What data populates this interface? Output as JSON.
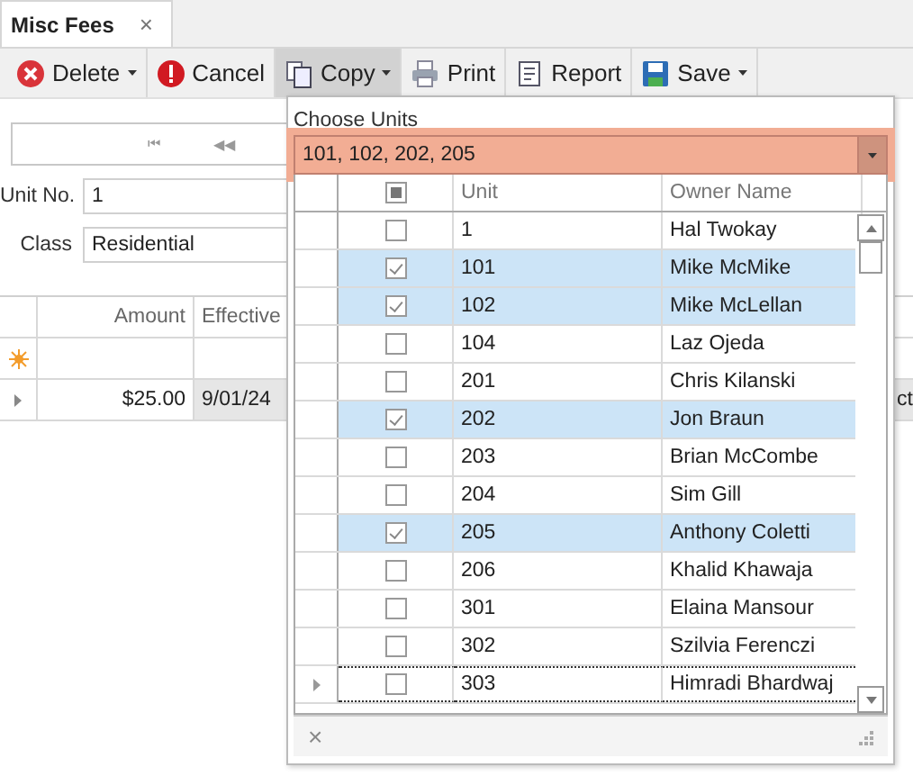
{
  "tabs": [
    {
      "label": "Misc Fees",
      "selected": true,
      "close": "×"
    }
  ],
  "toolbar": [
    {
      "kind": "delete",
      "label": "Delete",
      "dropdown": true,
      "pressed": false
    },
    {
      "kind": "cancel",
      "label": "Cancel",
      "dropdown": false,
      "pressed": false
    },
    {
      "kind": "copy",
      "label": "Copy",
      "dropdown": true,
      "pressed": true
    },
    {
      "kind": "print",
      "label": "Print",
      "dropdown": false,
      "pressed": false
    },
    {
      "kind": "report",
      "label": "Report",
      "dropdown": false,
      "pressed": false
    },
    {
      "kind": "save",
      "label": "Save",
      "dropdown": true,
      "pressed": false
    }
  ],
  "navigator": {
    "buttons": [
      "⏮",
      "◀◀"
    ]
  },
  "form": [
    {
      "label": "Unit No.",
      "value": "1"
    },
    {
      "label": "Class",
      "value": "Residential"
    }
  ],
  "grid": {
    "columns": [
      "Amount",
      "Effective"
    ],
    "rows": [
      {
        "kind": "new",
        "cells": [
          "",
          ""
        ]
      },
      {
        "kind": "data",
        "cells": [
          "$25.00",
          "9/01/24"
        ],
        "extra": "ct"
      }
    ]
  },
  "popup": {
    "title": "Choose Units",
    "value": "101, 102, 202, 205",
    "highlighted": true,
    "header_checkbox": {
      "indeterminate": true
    },
    "columns": [
      "Unit",
      "Owner Name"
    ],
    "rows": [
      {
        "unit": "1",
        "owner": "Hal Twokay",
        "checked": false,
        "current": false
      },
      {
        "unit": "101",
        "owner": "Mike McMike",
        "checked": true,
        "current": false
      },
      {
        "unit": "102",
        "owner": "Mike McLellan",
        "checked": true,
        "current": false
      },
      {
        "unit": "104",
        "owner": "Laz Ojeda",
        "checked": false,
        "current": false
      },
      {
        "unit": "201",
        "owner": "Chris Kilanski",
        "checked": false,
        "current": false
      },
      {
        "unit": "202",
        "owner": "Jon Braun",
        "checked": true,
        "current": false
      },
      {
        "unit": "203",
        "owner": "Brian McCombe",
        "checked": false,
        "current": false
      },
      {
        "unit": "204",
        "owner": "Sim Gill",
        "checked": false,
        "current": false
      },
      {
        "unit": "205",
        "owner": "Anthony Coletti",
        "checked": true,
        "current": false
      },
      {
        "unit": "206",
        "owner": "Khalid Khawaja",
        "checked": false,
        "current": false
      },
      {
        "unit": "301",
        "owner": "Elaina Mansour",
        "checked": false,
        "current": false
      },
      {
        "unit": "302",
        "owner": "Szilvia Ferenczi",
        "checked": false,
        "current": false
      },
      {
        "unit": "303",
        "owner": "Himradi Bhardwaj",
        "checked": false,
        "current": true
      }
    ],
    "footer_close": "×"
  }
}
